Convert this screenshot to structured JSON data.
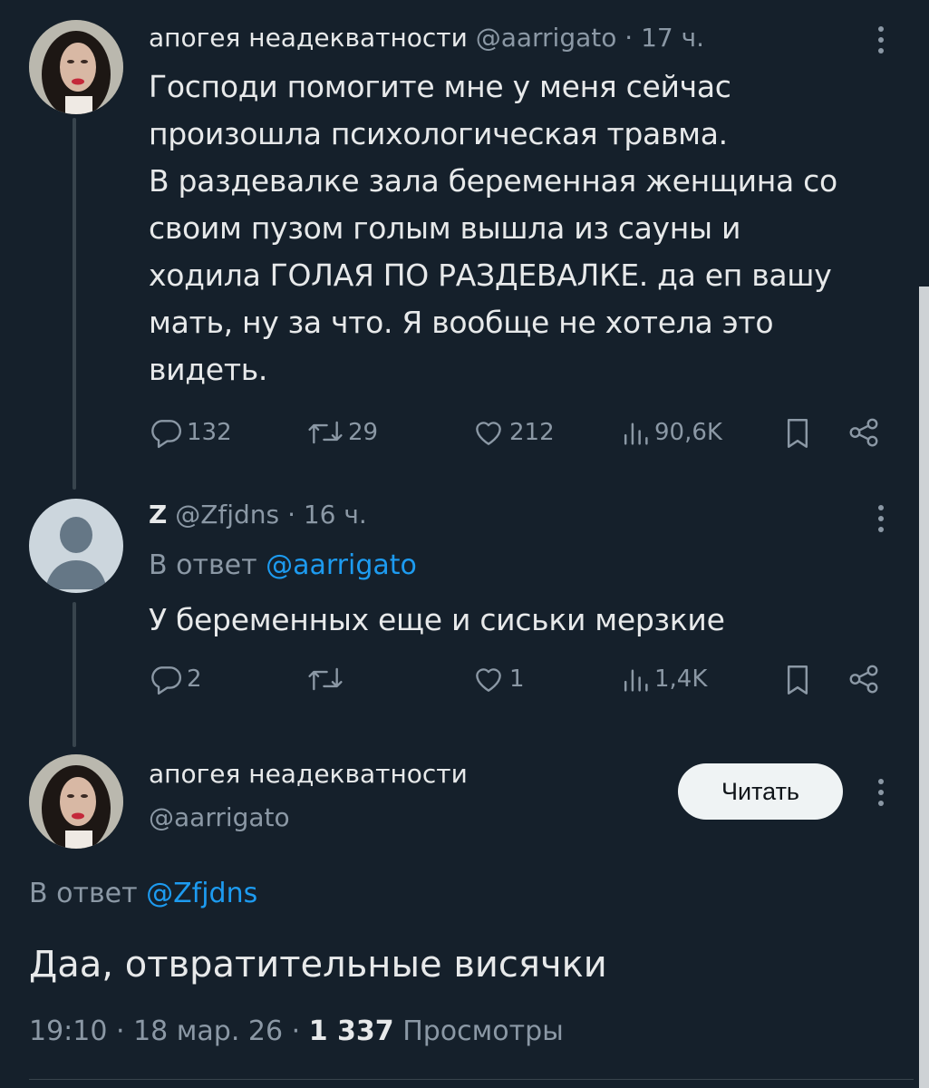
{
  "colors": {
    "background": "#15202b",
    "text": "#e7e9ea",
    "muted": "#8b98a5",
    "link": "#1d9bf0",
    "thread_line": "#38444d"
  },
  "tweet1": {
    "name": "апогея неадекватности",
    "handle": "@aarrigato",
    "time": "· 17 ч.",
    "text": "Господи помогите мне у меня сейчас\nпроизошла психологическая травма.\nВ раздевалке зала беременная женщина со\nсвоим пузом голым вышла из сауны и\nходила ГОЛАЯ ПО РАЗДЕВАЛКЕ. да еп вашу\nмать, ну за что. Я вообще не хотела это\nвидеть.",
    "replies": "132",
    "retweets": "29",
    "likes": "212",
    "views": "90,6K"
  },
  "tweet2": {
    "name": "Z",
    "handle": "@Zfjdns",
    "time": "· 16 ч.",
    "reply_prefix": "В ответ",
    "reply_to": "@aarrigato",
    "text": "У беременных еще и сиськи мерзкие",
    "replies": "2",
    "likes": "1",
    "views": "1,4K"
  },
  "tweet3": {
    "name": "апогея неадекватности",
    "handle": "@aarrigato",
    "follow_label": "Читать",
    "reply_prefix": "В ответ",
    "reply_to": "@Zfjdns",
    "text": "Даа, отвратительные висячки",
    "timestamp": "19:10 · 18 мар. 26 ·",
    "views_count": "1 337",
    "views_label": "Просмотры"
  },
  "icons": {
    "reply": "reply-icon",
    "retweet": "retweet-icon",
    "like": "heart-icon",
    "views": "views-icon",
    "bookmark": "bookmark-icon",
    "share": "share-icon",
    "more": "more-vertical-icon"
  }
}
